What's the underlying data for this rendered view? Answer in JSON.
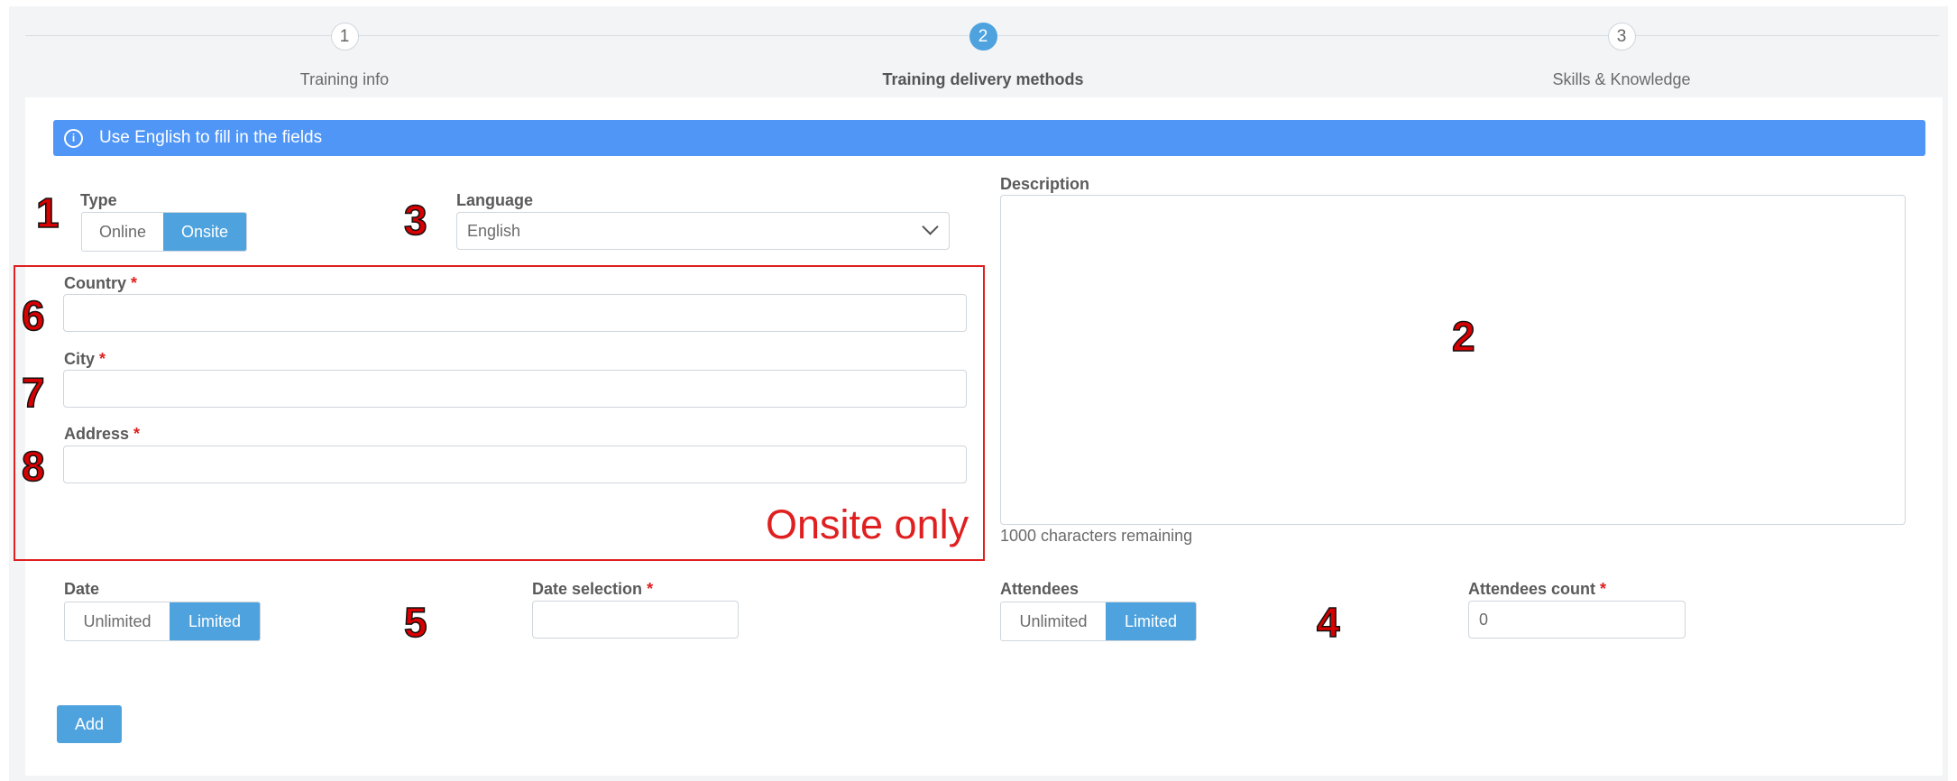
{
  "stepper": [
    {
      "number": "1",
      "label": "Training info",
      "active": false
    },
    {
      "number": "2",
      "label": "Training delivery methods",
      "active": true
    },
    {
      "number": "3",
      "label": "Skills & Knowledge",
      "active": false
    }
  ],
  "info_banner": {
    "icon": "info-icon",
    "text": "Use English to fill in the fields"
  },
  "type": {
    "label": "Type",
    "options": [
      "Online",
      "Onsite"
    ],
    "selected": "Onsite"
  },
  "language": {
    "label": "Language",
    "value": "English"
  },
  "description": {
    "label": "Description",
    "value": "",
    "remaining": "1000 characters remaining"
  },
  "country": {
    "label": "Country",
    "required": "*",
    "value": ""
  },
  "city": {
    "label": "City",
    "required": "*",
    "value": ""
  },
  "address": {
    "label": "Address",
    "required": "*",
    "value": ""
  },
  "onsite_note": "Onsite only",
  "date": {
    "label": "Date",
    "options": [
      "Unlimited",
      "Limited"
    ],
    "selected": "Limited"
  },
  "date_selection": {
    "label": "Date selection",
    "required": "*",
    "value": ""
  },
  "attendees": {
    "label": "Attendees",
    "options": [
      "Unlimited",
      "Limited"
    ],
    "selected": "Limited"
  },
  "attendees_count": {
    "label": "Attendees count",
    "required": "*",
    "value": "0"
  },
  "add_button": "Add",
  "markers": [
    "1",
    "2",
    "3",
    "4",
    "5",
    "6",
    "7",
    "8"
  ],
  "colors": {
    "accent": "#4ea3df",
    "banner": "#4f96f7",
    "annotation": "#e02020"
  }
}
